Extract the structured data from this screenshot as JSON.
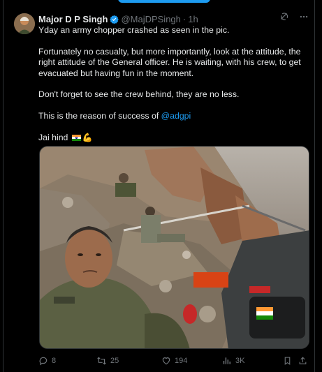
{
  "tweet": {
    "author_name": "Major D P Singh",
    "author_handle": "@MajDPSingh",
    "separator": "·",
    "time": "1h",
    "paragraphs": [
      "Yday an army chopper crashed as seen in the pic.",
      "Fortunately no casualty, but more importantly, look at the attitude, the right attitude of the General officer. He is waiting, with his crew, to get evacuated but having fun in the moment.",
      "Don't forget to see the crew behind, they are no less."
    ],
    "success_prefix": "This is the reason of success of ",
    "mention": "@adgpi",
    "signoff": "Jai hind",
    "icons": [
      "verified-icon",
      "grok-icon",
      "more-icon",
      "reply-icon",
      "repost-icon",
      "like-icon",
      "views-icon",
      "bookmark-icon",
      "share-icon"
    ],
    "colors": {
      "accent": "#1d9bf0",
      "background": "#000000",
      "text": "#e7e9ea",
      "muted": "#71767b"
    }
  },
  "stats": {
    "replies": "8",
    "reposts": "25",
    "likes": "194",
    "views": "3K"
  }
}
